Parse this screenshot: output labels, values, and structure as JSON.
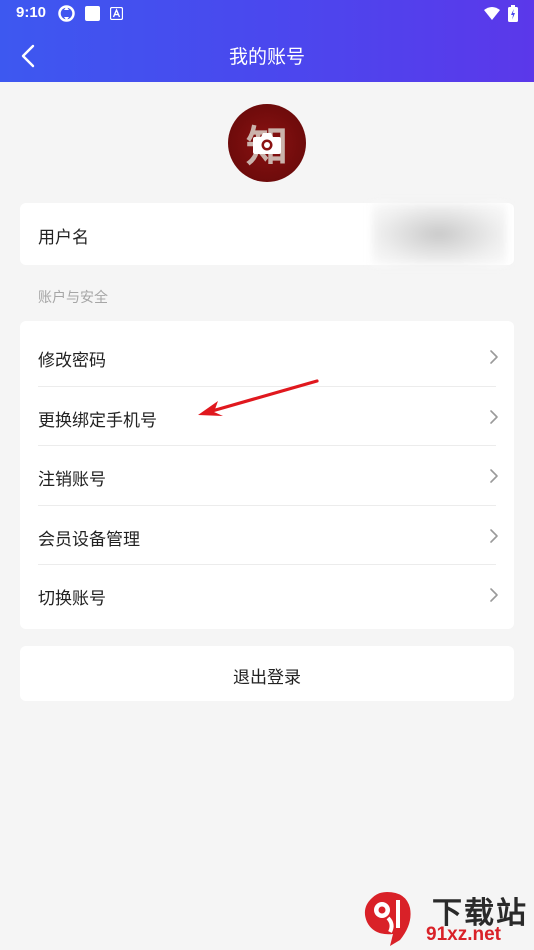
{
  "status_bar": {
    "time": "9:10",
    "icons": [
      "sync-icon",
      "square-icon",
      "a-badge-icon",
      "wifi-icon",
      "battery-icon"
    ]
  },
  "header": {
    "title": "我的账号",
    "back_icon": "chevron-left-icon",
    "gradient": [
      "#3d58f0",
      "#5b38ea"
    ]
  },
  "profile": {
    "avatar_glyph": "知",
    "avatar_color": "#7a0e0e"
  },
  "username_row": {
    "label": "用户名",
    "value": ""
  },
  "account_security": {
    "section_title": "账户与安全",
    "items": [
      {
        "label": "修改密码"
      },
      {
        "label": "更换绑定手机号"
      },
      {
        "label": "注销账号"
      },
      {
        "label": "会员设备管理"
      },
      {
        "label": "切换账号"
      }
    ]
  },
  "logout": {
    "label": "退出登录"
  },
  "annotation": {
    "arrow_color": "#e0181e"
  },
  "watermark": {
    "title": "下载站",
    "url": "91xz.net",
    "brand_color": "#d92128"
  }
}
